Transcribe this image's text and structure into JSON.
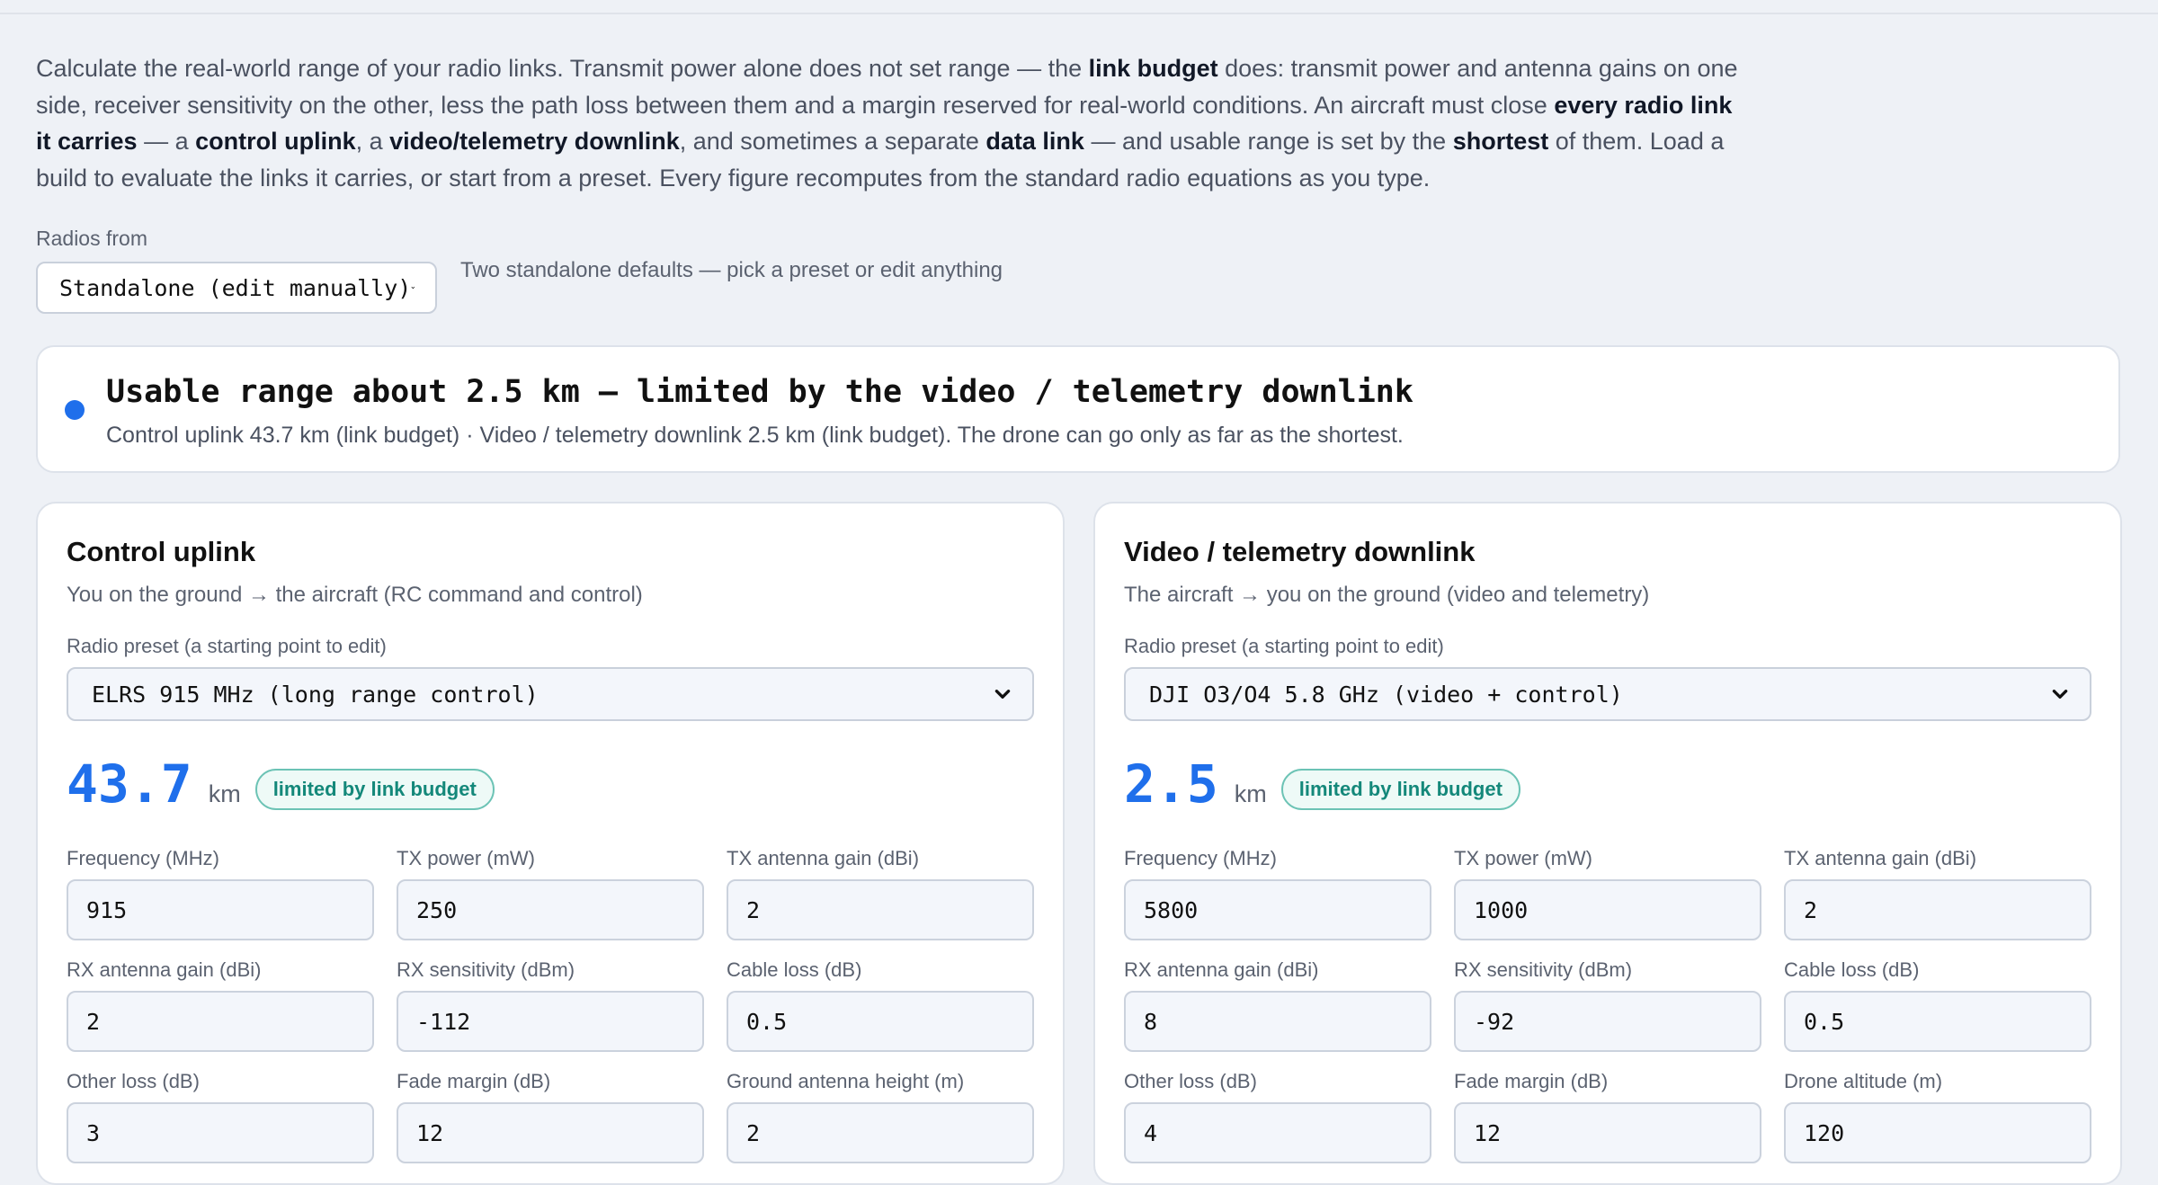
{
  "intro": {
    "parts": [
      {
        "text": "Calculate the real-world range of your radio links. Transmit power alone does not set range — the ",
        "bold": false
      },
      {
        "text": "link budget",
        "bold": true
      },
      {
        "text": " does: transmit power and antenna gains on one side, receiver sensitivity on the other, less the path loss between them and a margin reserved for real-world conditions. An aircraft must close ",
        "bold": false
      },
      {
        "text": "every radio link it carries",
        "bold": true
      },
      {
        "text": " — a ",
        "bold": false
      },
      {
        "text": "control uplink",
        "bold": true
      },
      {
        "text": ", a ",
        "bold": false
      },
      {
        "text": "video/telemetry downlink",
        "bold": true
      },
      {
        "text": ", and sometimes a separate ",
        "bold": false
      },
      {
        "text": "data link",
        "bold": true
      },
      {
        "text": " — and usable range is set by the ",
        "bold": false
      },
      {
        "text": "shortest",
        "bold": true
      },
      {
        "text": " of them. Load a build to evaluate the links it carries, or start from a preset. Every figure recomputes from the standard radio equations as you type.",
        "bold": false
      }
    ]
  },
  "radios": {
    "label": "Radios from",
    "selected": "Standalone (edit manually)",
    "hint": "Two standalone defaults — pick a preset or edit anything"
  },
  "summary": {
    "headline": "Usable range about 2.5 km — limited by the video / telemetry downlink",
    "detail": "Control uplink 43.7 km (link budget) · Video / telemetry downlink 2.5 km (link budget). The drone can go only as far as the shortest.",
    "dot_color": "#1f6feb"
  },
  "uplink": {
    "title": "Control uplink",
    "desc": "You on the ground → the aircraft (RC command and control)",
    "preset_label": "Radio preset (a starting point to edit)",
    "preset": "ELRS 915 MHz (long range control)",
    "range": "43.7",
    "unit": "km",
    "badge": "limited by link budget",
    "fields": [
      {
        "label": "Frequency (MHz)",
        "value": "915"
      },
      {
        "label": "TX power (mW)",
        "value": "250"
      },
      {
        "label": "TX antenna gain (dBi)",
        "value": "2"
      },
      {
        "label": "RX antenna gain (dBi)",
        "value": "2"
      },
      {
        "label": "RX sensitivity (dBm)",
        "value": "-112"
      },
      {
        "label": "Cable loss (dB)",
        "value": "0.5"
      },
      {
        "label": "Other loss (dB)",
        "value": "3"
      },
      {
        "label": "Fade margin (dB)",
        "value": "12"
      },
      {
        "label": "Ground antenna height (m)",
        "value": "2"
      }
    ]
  },
  "downlink": {
    "title": "Video / telemetry downlink",
    "desc": "The aircraft → you on the ground (video and telemetry)",
    "preset_label": "Radio preset (a starting point to edit)",
    "preset": "DJI O3/O4 5.8 GHz (video + control)",
    "range": "2.5",
    "unit": "km",
    "badge": "limited by link budget",
    "fields": [
      {
        "label": "Frequency (MHz)",
        "value": "5800"
      },
      {
        "label": "TX power (mW)",
        "value": "1000"
      },
      {
        "label": "TX antenna gain (dBi)",
        "value": "2"
      },
      {
        "label": "RX antenna gain (dBi)",
        "value": "8"
      },
      {
        "label": "RX sensitivity (dBm)",
        "value": "-92"
      },
      {
        "label": "Cable loss (dB)",
        "value": "0.5"
      },
      {
        "label": "Other loss (dB)",
        "value": "4"
      },
      {
        "label": "Fade margin (dB)",
        "value": "12"
      },
      {
        "label": "Drone altitude (m)",
        "value": "120"
      }
    ]
  },
  "colors": {
    "accent": "#1f6feb",
    "badge": "#14887a"
  }
}
